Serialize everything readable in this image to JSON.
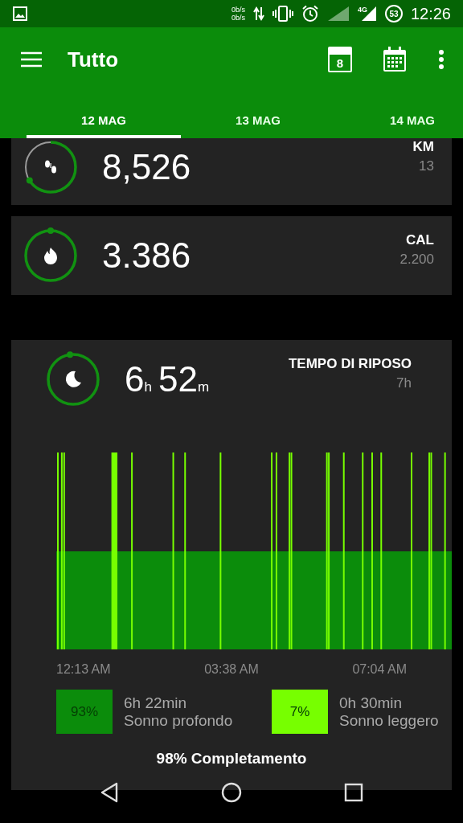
{
  "status_bar": {
    "net_up": "0b/s",
    "net_down": "0b/s",
    "network": "4G",
    "battery": "53",
    "time": "12:26"
  },
  "app_bar": {
    "title": "Tutto",
    "calendar_day": "8"
  },
  "tabs": [
    {
      "label": "12 MAG",
      "selected": true
    },
    {
      "label": "13 MAG",
      "selected": false
    },
    {
      "label": "14 MAG",
      "selected": false
    }
  ],
  "cards": [
    {
      "kind": "distance",
      "value": [
        {
          "n": "8,526"
        }
      ],
      "label": "KM",
      "goal": "13"
    },
    {
      "kind": "calories",
      "value": [
        {
          "n": "3.386"
        }
      ],
      "label": "CAL",
      "goal": "2.200"
    },
    {
      "kind": "sleep",
      "value": [
        {
          "n": "6",
          "u": "h"
        },
        {
          "n": "52",
          "u": "m"
        }
      ],
      "label": "TEMPO DI RIPOSO",
      "goal": "7h"
    }
  ],
  "sleep": {
    "axis": [
      "12:13 AM",
      "03:38 AM",
      "07:04 AM"
    ],
    "legend": [
      {
        "percent": "93%",
        "duration": "6h 22min",
        "name": "Sonno profondo",
        "color": "#0b8c0b"
      },
      {
        "percent": "7%",
        "duration": "0h 30min",
        "name": "Sonno leggero",
        "color": "#77ff00"
      }
    ],
    "completion": "98% Completamento"
  }
}
